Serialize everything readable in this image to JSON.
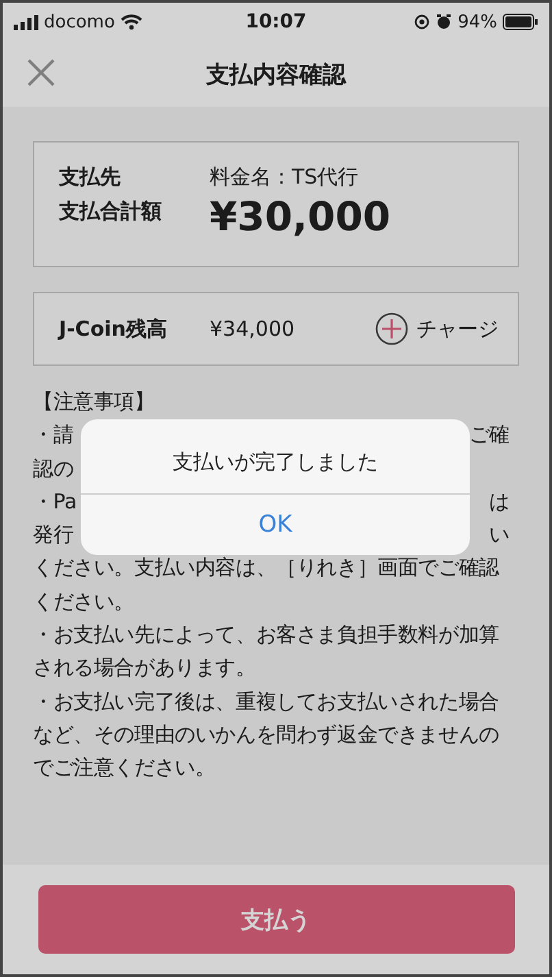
{
  "status_bar": {
    "carrier": "docomo",
    "time": "10:07",
    "battery": "94%"
  },
  "header": {
    "title": "支払内容確認"
  },
  "payment": {
    "payee_label": "支払先",
    "total_label": "支払合計額",
    "fee_name": "料金名：TS代行",
    "amount": "¥30,000"
  },
  "balance": {
    "label": "J-Coin残高",
    "amount": "¥34,000",
    "charge": "チャージ"
  },
  "notes": {
    "heading": "【注意事項】",
    "lines": [
      [
        "・請",
        "ご確"
      ],
      [
        "認の"
      ],
      [
        "・Pa",
        "は"
      ],
      [
        "発行",
        "い"
      ],
      [
        "ください。支払い内容は、［りれき］画面でご確認"
      ],
      [
        "ください。"
      ],
      [
        "・お支払い先によって、お客さま負担手数料が加算"
      ],
      [
        "される場合があります。"
      ],
      [
        "・お支払い完了後は、重複してお支払いされた場合"
      ],
      [
        "など、その理由のいかんを問わず返金できませんの"
      ],
      [
        "でご注意ください。"
      ]
    ]
  },
  "pay_button": "支払う",
  "dialog": {
    "message": "支払いが完了しました",
    "button": "OK"
  }
}
